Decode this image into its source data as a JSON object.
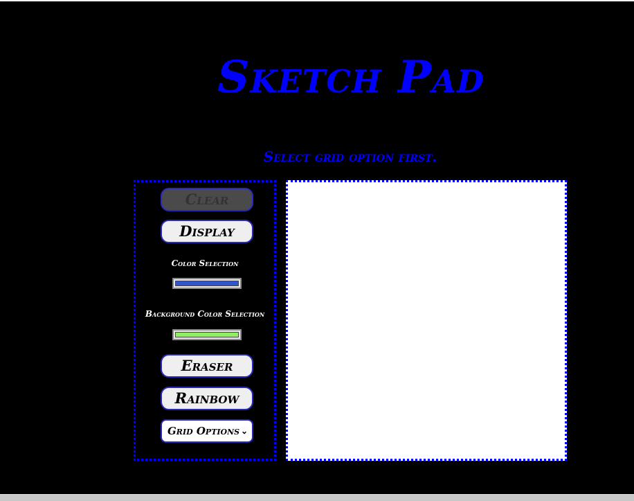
{
  "header": {
    "title": "Sketch Pad",
    "instruction": "Select grid option first."
  },
  "controls": {
    "clear_label": "Clear",
    "display_label": "Display",
    "color_selection_label": "Color Selection",
    "color_value": "#3355cc",
    "background_color_label": "Background Color Selection",
    "background_color_value": "#90ee60",
    "eraser_label": "Eraser",
    "rainbow_label": "Rainbow",
    "grid_options": {
      "selected": "Grid Options"
    }
  },
  "colors": {
    "accent": "#0000ff",
    "background": "#000000",
    "canvas": "#ffffff"
  }
}
